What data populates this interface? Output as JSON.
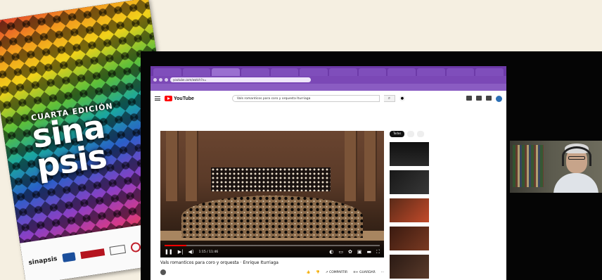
{
  "poster": {
    "edition": "CUARTA EDICIÓN",
    "title_line1": "sina",
    "title_line2": "psis",
    "footer_logo": "sinapsis"
  },
  "browser": {
    "tabs": [
      "",
      "",
      "",
      "",
      "",
      "",
      "",
      "",
      "",
      "",
      "",
      ""
    ],
    "active_tab": 2,
    "url": "youtube.com/watch?v=",
    "bookmarks": [
      "",
      "",
      "",
      "",
      "",
      ""
    ]
  },
  "youtube": {
    "logo_text": "YouTube",
    "search_value": "Vals romanticos para coro y orquesta Iturriaga",
    "search_icon": "search-icon",
    "video": {
      "time": "1:15 / 11:46",
      "progress": 0.1,
      "title": "Vals romanticos para coro y orquesta · Enrique Iturriaga",
      "channel": "",
      "subs": "",
      "likes": "",
      "share": "COMPARTIR",
      "save": "GUARDAR"
    },
    "chips": [
      {
        "label": "Todos",
        "active": true
      },
      {
        "label": "",
        "active": false
      },
      {
        "label": "",
        "active": false
      }
    ],
    "recommendations": [
      {
        "title": "",
        "meta": "",
        "duration": "",
        "live": ""
      },
      {
        "title": "",
        "meta": "",
        "duration": "",
        "live": ""
      },
      {
        "title": "",
        "meta": "",
        "duration": "",
        "live": ""
      },
      {
        "title": "",
        "meta": "",
        "duration": "",
        "live": ""
      },
      {
        "title": "",
        "meta": "",
        "duration": "",
        "live": ""
      }
    ]
  },
  "colors": {
    "browser_purple": "#6d3aa8",
    "yt_red": "#ff0000",
    "background": "#f5efe1"
  }
}
